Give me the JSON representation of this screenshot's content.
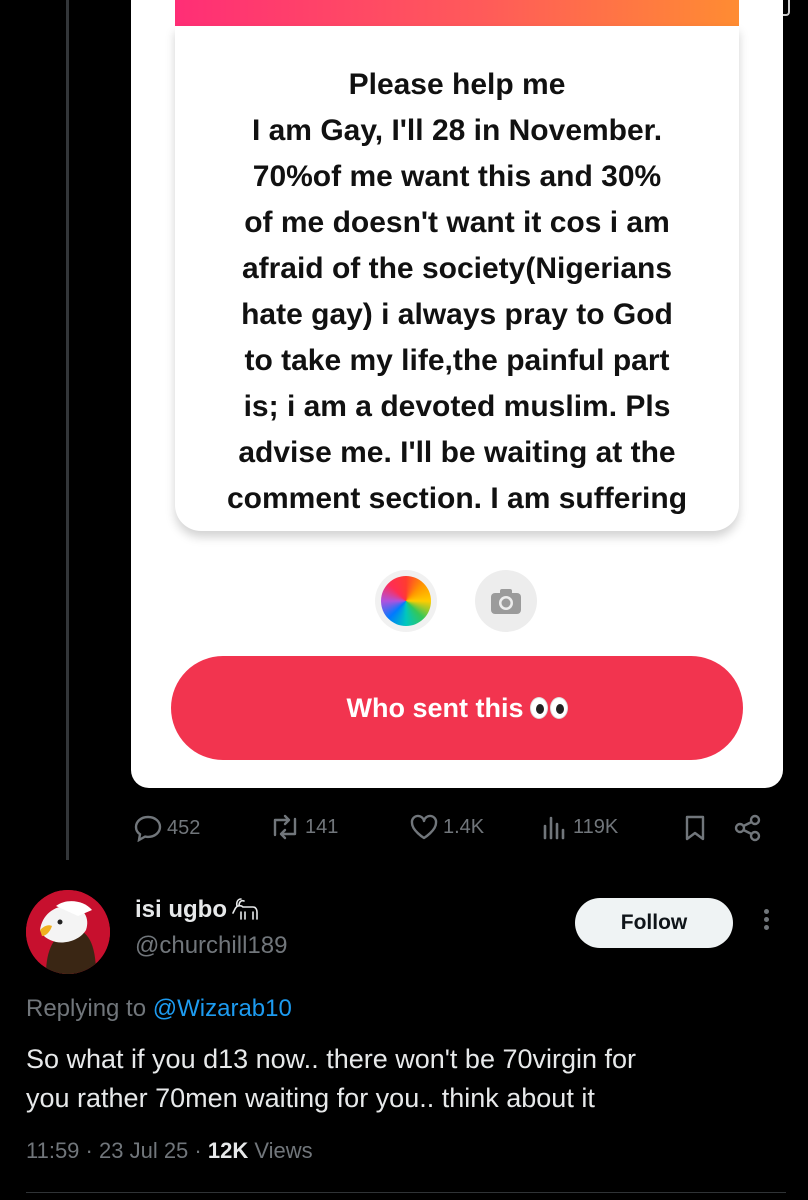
{
  "message_card": {
    "text": "Please help me\nI am Gay, I'll 28 in November.\n70%of me want this and 30%\nof me doesn't want it cos i am\nafraid of the society(Nigerians\nhate gay) i always pray to God\nto take my life,the painful part\nis; i am a devoted muslim. Pls\nadvise me. I'll be waiting at the\ncomment section. I am suffering",
    "cta_label": "Who sent this",
    "cta_emoji": "eyes-emoji",
    "accent_color": "#f2344f"
  },
  "post_stats": {
    "replies": "452",
    "reposts": "141",
    "likes": "1.4K",
    "views": "119K"
  },
  "reply": {
    "display_name": "isi ugbo",
    "name_emoji": "goat-emoji",
    "handle": "@churchill189",
    "follow_label": "Follow",
    "replying_prefix": "Replying to",
    "replying_to": "@Wizarab10",
    "text": "So what if you d13 now.. there won't be 70virgin for\nyou rather 70men waiting for you.. think about it",
    "time": "11:59",
    "date": "23 Jul 25",
    "views_count": "12K",
    "views_label": "Views"
  }
}
